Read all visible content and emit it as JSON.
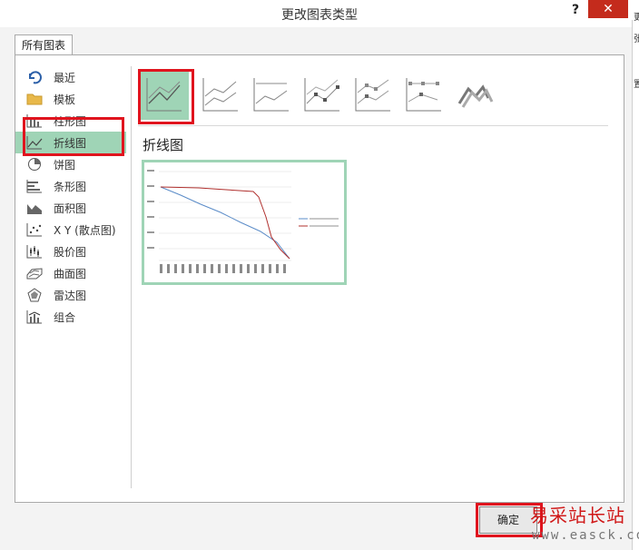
{
  "window": {
    "title": "更改图表类型",
    "help": "?",
    "close": "✕"
  },
  "tab": {
    "label": "所有图表"
  },
  "sidebar": {
    "items": [
      {
        "icon": "recent-icon",
        "label": "最近"
      },
      {
        "icon": "folder-icon",
        "label": "模板"
      },
      {
        "icon": "column-chart-icon",
        "label": "柱形图"
      },
      {
        "icon": "line-chart-icon",
        "label": "折线图",
        "selected": true
      },
      {
        "icon": "pie-chart-icon",
        "label": "饼图"
      },
      {
        "icon": "bar-chart-icon",
        "label": "条形图"
      },
      {
        "icon": "area-chart-icon",
        "label": "面积图"
      },
      {
        "icon": "scatter-chart-icon",
        "label": "X Y (散点图)"
      },
      {
        "icon": "stock-chart-icon",
        "label": "股价图"
      },
      {
        "icon": "surface-chart-icon",
        "label": "曲面图"
      },
      {
        "icon": "radar-chart-icon",
        "label": "雷达图"
      },
      {
        "icon": "combo-chart-icon",
        "label": "组合"
      }
    ]
  },
  "chart_heading": "折线图",
  "footer": {
    "ok_label": "确定"
  },
  "watermark": {
    "line1": "易采站长站",
    "line2": "www.easck.com"
  },
  "right_edge_fragments": [
    "更",
    "张",
    "置"
  ],
  "colors": {
    "selection": "#9fd4b6",
    "highlight": "#e0141e",
    "series_blue": "#5b8cc8",
    "series_red": "#b0302e"
  }
}
